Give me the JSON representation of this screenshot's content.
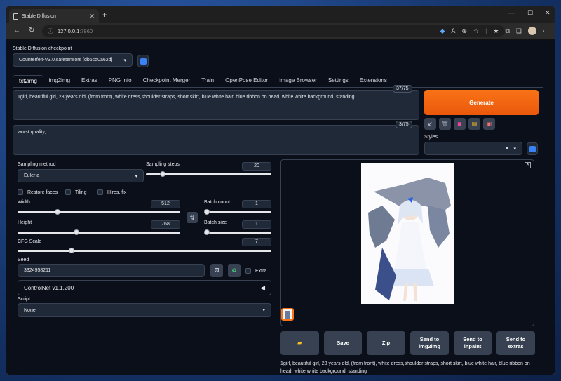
{
  "browser": {
    "tab_title": "Stable Diffusion",
    "url_host": "127.0.0.1",
    "url_port": ":7860"
  },
  "checkpoint": {
    "label": "Stable Diffusion checkpoint",
    "value": "Counterfeit-V3.0.safetensors [db6cd0a62d]"
  },
  "tabs": [
    "txt2img",
    "img2img",
    "Extras",
    "PNG Info",
    "Checkpoint Merger",
    "Train",
    "OpenPose Editor",
    "Image Browser",
    "Settings",
    "Extensions"
  ],
  "prompt": {
    "text": "1girl, beautiful girl, 28 years old,  (from front), white dress,shoulder straps, short skirt, blue white hair, blue ribbon on head, white white background,  standing",
    "count": "37/75"
  },
  "negative": {
    "text": "worst quality,",
    "count": "3/75"
  },
  "generate_label": "Generate",
  "styles_label": "Styles",
  "sampling": {
    "method_label": "Sampling method",
    "method_value": "Euler a",
    "steps_label": "Sampling steps",
    "steps_value": "20"
  },
  "checks": {
    "restore_faces": "Restore faces",
    "tiling": "Tiling",
    "hires_fix": "Hires. fix",
    "extra": "Extra"
  },
  "width": {
    "label": "Width",
    "value": "512"
  },
  "height": {
    "label": "Height",
    "value": "768"
  },
  "batch_count": {
    "label": "Batch count",
    "value": "1"
  },
  "batch_size": {
    "label": "Batch size",
    "value": "1"
  },
  "cfg": {
    "label": "CFG Scale",
    "value": "7"
  },
  "seed": {
    "label": "Seed",
    "value": "3324958211"
  },
  "controlnet_label": "ControlNet v1.1.200",
  "script": {
    "label": "Script",
    "value": "None"
  },
  "output_buttons": {
    "save": "Save",
    "zip": "Zip",
    "send_img2img": "Send to img2img",
    "send_inpaint": "Send to inpaint",
    "send_extras": "Send to extras"
  },
  "output_caption": "1girl, beautiful girl, 28 years old, (from front), white dress,shoulder straps, short skirt, blue white hair, blue ribbon on head, white white background, standing",
  "colors": {
    "accent": "#f97316",
    "background": "#0b0f19",
    "panel": "#1f2937"
  }
}
